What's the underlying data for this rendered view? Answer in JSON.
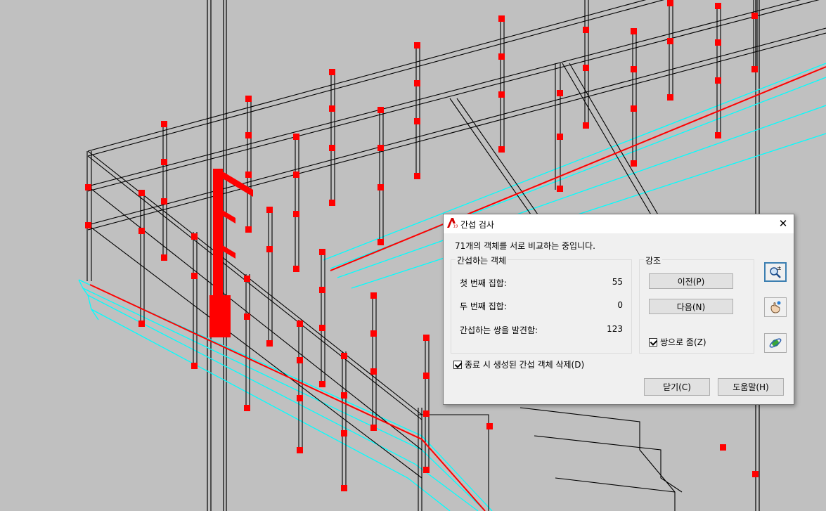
{
  "dialog": {
    "title": "간섭 검사",
    "message": "71개의 객체를 서로 비교하는 중입니다.",
    "interfering_objects": {
      "group_title": "간섭하는 객체",
      "first_set_label": "첫 번째 집합:",
      "first_set_value": "55",
      "second_set_label": "두 번째 집합:",
      "second_set_value": "0",
      "pairs_found_label": "간섭하는 쌍을 발견함:",
      "pairs_found_value": "123"
    },
    "highlight": {
      "group_title": "강조",
      "previous_button": "이전(P)",
      "next_button": "다음(N)",
      "zoom_to_pair_label": "쌍으로 줌(Z)",
      "zoom_to_pair_checked": true
    },
    "delete_on_close_label": "종료 시 생성된 간섭 객체 삭제(D)",
    "delete_on_close_checked": true,
    "close_button": "닫기(C)",
    "help_button": "도움말(H)",
    "tools": [
      "zoom-realtime-icon",
      "pan-icon",
      "orbit-icon"
    ]
  },
  "colors": {
    "background": "#c0c0c0",
    "wire_black": "#000000",
    "wire_cyan": "#00ffff",
    "interference_red": "#ff0000"
  }
}
